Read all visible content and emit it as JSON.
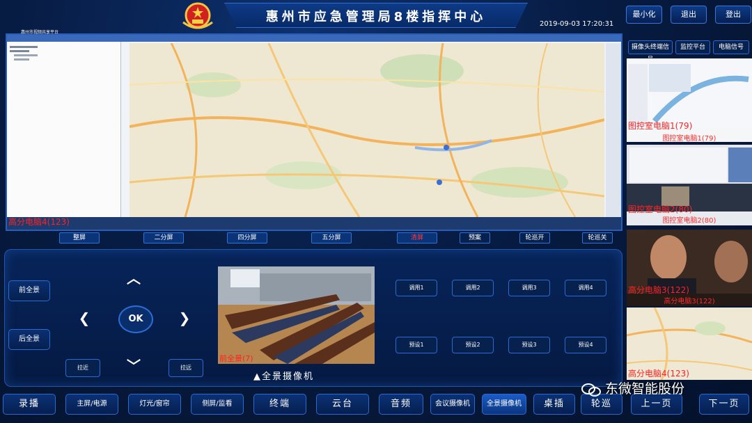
{
  "header": {
    "title": "惠州市应急管理局8楼指挥中心",
    "datetime": "2019-09-03 17:20:31",
    "buttons": {
      "minimize": "最小化",
      "exit": "退出",
      "logout": "登出"
    }
  },
  "main_screen": {
    "panel_title": "惠州市视频共享平台",
    "source_label": "高分电脑4(123)"
  },
  "screen_modes": {
    "full": "整屏",
    "two": "二分屏",
    "four": "四分屏",
    "five": "五分屏",
    "clear": "清屏",
    "plan": "预案",
    "patrol_on": "轮巡开",
    "patrol_off": "轮巡关"
  },
  "camera_control": {
    "front_panorama": "前全景",
    "rear_panorama": "后全景",
    "ok": "OK",
    "zoom_near": "拉近",
    "zoom_far": "拉远",
    "view_label": "前全景(7)",
    "camera_title": "▲全景摄像机",
    "recall": [
      "调用1",
      "调用2",
      "调用3",
      "调用4"
    ],
    "preset": [
      "预设1",
      "预设2",
      "预设3",
      "预设4"
    ]
  },
  "right_column": {
    "tabs": {
      "camera_signal": "摄像头终端信号",
      "monitor_platform": "监控平台",
      "pc_signal": "电脑信号"
    },
    "thumbnails": [
      {
        "overlay": "图控室电脑1(79)",
        "caption": "图控室电脑1(79)"
      },
      {
        "overlay": "图控室电脑2(80)",
        "caption": "图控室电脑2(80)"
      },
      {
        "overlay": "高分电脑3(122)",
        "caption": "高分电脑3(122)"
      },
      {
        "overlay": "高分电脑4(123)",
        "caption": ""
      }
    ]
  },
  "bottom_bar": {
    "record": "录播",
    "main_screen_power": "主屏/电源",
    "light_curtain": "灯光/窗帘",
    "side_screen": "侧屏/监看",
    "terminal": "终端",
    "ptz": "云台",
    "audio": "音频",
    "meeting_camera": "会议摄像机",
    "panorama_camera": "全景摄像机",
    "desktop": "桌插",
    "patrol": "轮巡",
    "prev_page": "上一页",
    "next_page": "下一页"
  },
  "watermark": "东微智能股份",
  "colors": {
    "accent": "#2b6ad0",
    "label_red": "#ff2222",
    "background": "#061a3a"
  }
}
